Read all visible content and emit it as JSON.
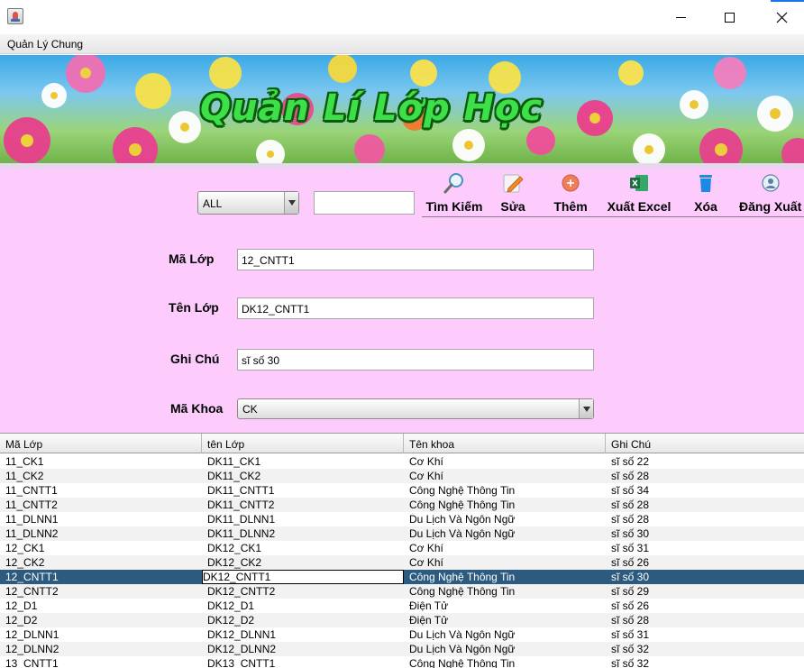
{
  "window": {
    "menu": "Quản Lý Chung"
  },
  "banner": {
    "title": "Quản Lí Lớp Học"
  },
  "search": {
    "filter_value": "ALL",
    "query_value": ""
  },
  "toolbar": {
    "search_label": "Tìm Kiếm",
    "edit_label": "Sửa",
    "add_label": "Thêm",
    "export_label": "Xuất Excel",
    "delete_label": "Xóa",
    "logout_label": "Đăng Xuất"
  },
  "form": {
    "class_id_label": "Mã Lớp",
    "class_id_value": "12_CNTT1",
    "class_name_label": "Tên Lớp",
    "class_name_value": "DK12_CNTT1",
    "note_label": "Ghi Chú",
    "note_value": "sĩ số 30",
    "faculty_label": "Mã Khoa",
    "faculty_value": "CK"
  },
  "table": {
    "headers": [
      "Mã Lớp",
      "tên Lớp",
      "Tên khoa",
      "Ghi Chú"
    ],
    "rows": [
      [
        "11_CK1",
        "DK11_CK1",
        "Cơ Khí",
        "sĩ số 22"
      ],
      [
        "11_CK2",
        "DK11_CK2",
        "Cơ Khí",
        "sĩ số 28"
      ],
      [
        "11_CNTT1",
        "DK11_CNTT1",
        "Công Nghệ Thông Tin",
        "sĩ số 34"
      ],
      [
        "11_CNTT2",
        "DK11_CNTT2",
        "Công Nghệ Thông Tin",
        "sĩ số 28"
      ],
      [
        "11_DLNN1",
        "DK11_DLNN1",
        "Du Lịch Và Ngôn Ngữ",
        "sĩ số 28"
      ],
      [
        "11_DLNN2",
        "DK11_DLNN2",
        "Du Lịch Và Ngôn Ngữ",
        "sĩ số 30"
      ],
      [
        "12_CK1",
        "DK12_CK1",
        "Cơ Khí",
        "sĩ số 31"
      ],
      [
        "12_CK2",
        "DK12_CK2",
        "Cơ Khí",
        "sĩ số 26"
      ],
      [
        "12_CNTT1",
        "DK12_CNTT1",
        "Công Nghệ Thông Tin",
        "sĩ số 30"
      ],
      [
        "12_CNTT2",
        "DK12_CNTT2",
        "Công Nghệ Thông Tin",
        "sĩ số 29"
      ],
      [
        "12_D1",
        "DK12_D1",
        "Điện Tử",
        "sĩ số 26"
      ],
      [
        "12_D2",
        "DK12_D2",
        "Điện Tử",
        "sĩ số 28"
      ],
      [
        "12_DLNN1",
        "DK12_DLNN1",
        "Du Lịch Và Ngôn Ngữ",
        "sĩ số 31"
      ],
      [
        "12_DLNN2",
        "DK12_DLNN2",
        "Du Lịch Và Ngôn Ngữ",
        "sĩ số 32"
      ],
      [
        "13_CNTT1",
        "DK13_CNTT1",
        "Công Nghệ Thông Tin",
        "sĩ số 32"
      ]
    ]
  },
  "colors": {
    "form_bg": "#fdccfd",
    "selection": "#2d5b7f",
    "banner_text": "#3ee04a"
  },
  "icons": [
    "app-icon",
    "search-icon",
    "pencil-icon",
    "add-circle-icon",
    "excel-icon",
    "trash-icon",
    "user-icon"
  ]
}
